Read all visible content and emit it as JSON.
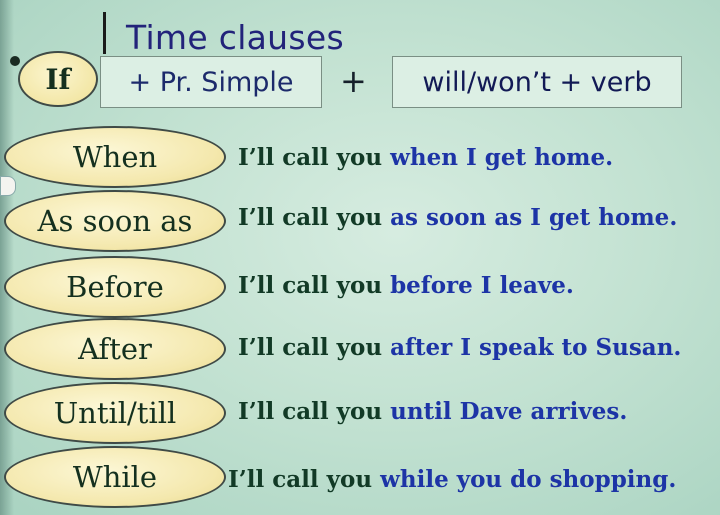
{
  "title": "Time clauses",
  "formula": {
    "conjunction": "If",
    "part1": "+ Pr. Simple",
    "plus": "+",
    "part2": "will/won’t + verb"
  },
  "rows": [
    {
      "conjunction": "When",
      "main": "I’ll call you",
      "clause": "when I get home."
    },
    {
      "conjunction": "As soon as",
      "main": "I’ll call you",
      "clause": "as soon as I get home."
    },
    {
      "conjunction": "Before",
      "main": "I’ll call you",
      "clause": "before I leave."
    },
    {
      "conjunction": "After",
      "main": "I’ll call you",
      "clause": "after I speak to Susan."
    },
    {
      "conjunction": "Until/till",
      "main": "I’ll call you",
      "clause": "until Dave arrives."
    },
    {
      "conjunction": "While",
      "main": "I’ll call you",
      "clause": "while you do shopping."
    }
  ],
  "colors": {
    "title": "#22237a",
    "oval_fill": "#f4e8ad",
    "main_text": "#123a26",
    "clause_text": "#1d34a6",
    "background": "#c3e2d2"
  }
}
